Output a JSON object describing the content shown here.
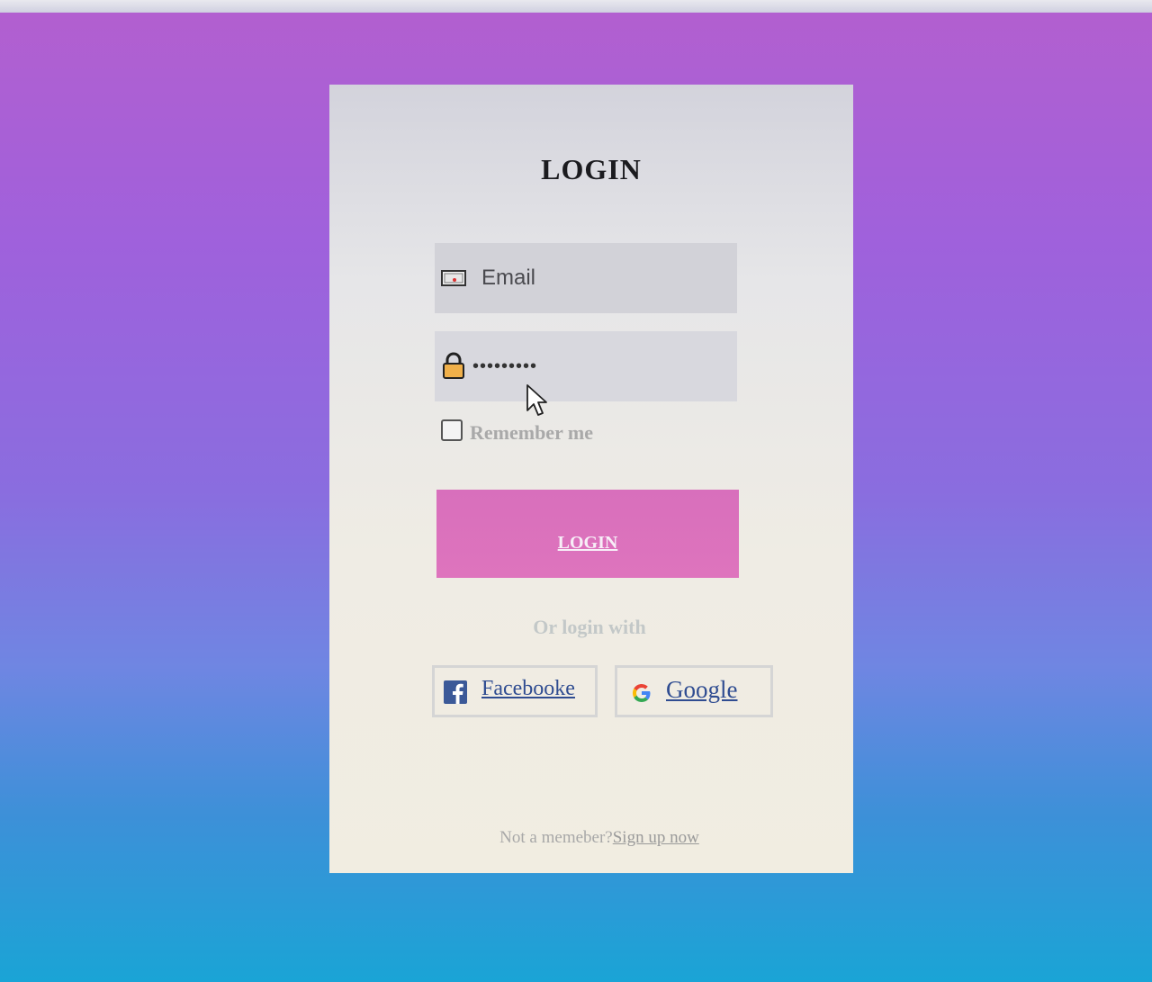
{
  "login_card": {
    "title": "LOGIN",
    "email": {
      "placeholder": "Email",
      "icon": "envelope-icon"
    },
    "password": {
      "value": "•••••••••",
      "icon": "lock-icon"
    },
    "remember_me": {
      "label": "Remember me",
      "checked": false
    },
    "submit_label": "LOGIN",
    "or_text": "Or login with",
    "social": {
      "facebook": {
        "label": "Facebooke",
        "icon": "facebook-icon"
      },
      "google": {
        "label": "Google",
        "icon": "google-icon"
      }
    },
    "footer": {
      "text": "Not a memeber?",
      "link": "Sign up now"
    }
  },
  "colors": {
    "button": "#dc72bd",
    "card": "#efece4",
    "link": "#2f4c91",
    "field": "#d2d2d8"
  }
}
